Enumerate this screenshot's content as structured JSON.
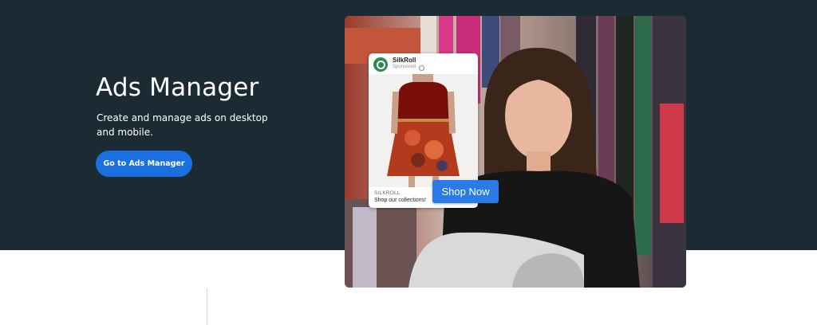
{
  "hero": {
    "title": "Ads Manager",
    "description": "Create and manage ads on desktop and mobile.",
    "cta_label": "Go to Ads Manager",
    "background_color": "#1c2b33",
    "cta_color": "#1b6fe0"
  },
  "ad_preview": {
    "brand_name": "SilkRoll",
    "sponsored_label": "Sponsored ·",
    "caption_brand": "SILKROLL",
    "caption_text": "Shop our collections!",
    "shop_button_label": "Shop Now",
    "logo_icon": "silkroll-logo-icon",
    "privacy_icon": "globe-icon",
    "button_color": "#2a7be8",
    "logo_color": "#2d8a55"
  }
}
